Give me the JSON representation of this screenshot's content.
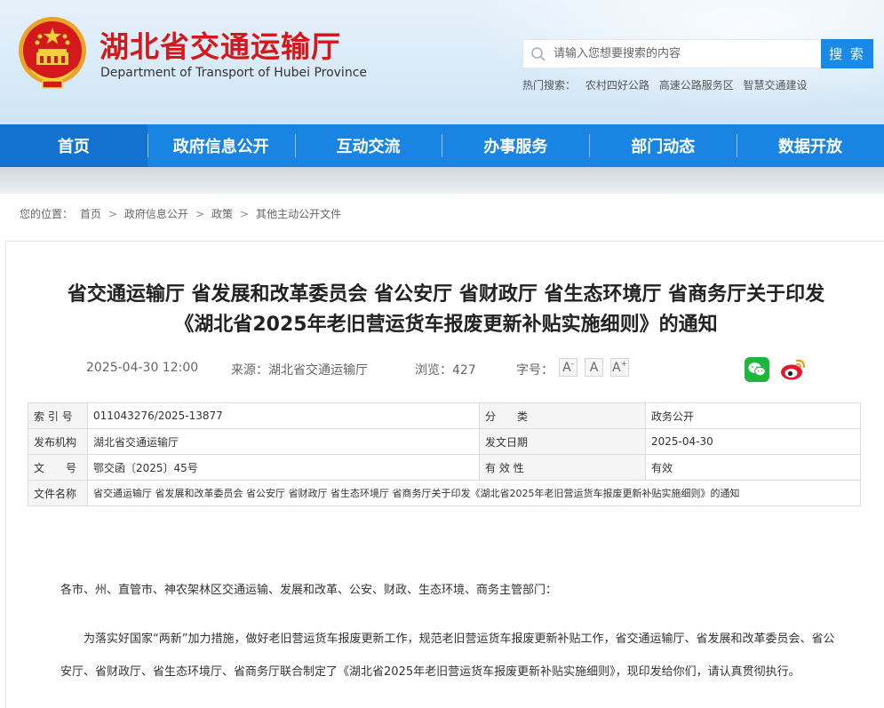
{
  "header": {
    "title": "湖北省交通运输厅",
    "subtitle": "Department of Transport of Hubei Province"
  },
  "search": {
    "placeholder": "请输入您想要搜索的内容",
    "button": "搜 索",
    "hot_label": "热门搜索：",
    "hot_items": [
      "农村四好公路",
      "高速公路服务区",
      "智慧交通建设"
    ]
  },
  "nav": [
    "首页",
    "政府信息公开",
    "互动交流",
    "办事服务",
    "部门动态",
    "数据开放"
  ],
  "breadcrumb": {
    "label": "您的位置：",
    "items": [
      "首页",
      "政府信息公开",
      "政策",
      "其他主动公开文件"
    ],
    "separator": ">"
  },
  "article": {
    "title_line1": "省交通运输厅 省发展和改革委员会 省公安厅 省财政厅 省生态环境厅 省商务厅关于印发",
    "title_line2": "《湖北省2025年老旧营运货车报废更新补贴实施细则》的通知",
    "datetime": "2025-04-30 12:00",
    "source_label": "来源：",
    "source": "湖北省交通运输厅",
    "views_label": "浏览：",
    "views": "427",
    "font_label": "字号：",
    "font_small": "A",
    "font_mid": "A",
    "font_large": "A",
    "font_large_sup": "+",
    "font_small_sup": "-"
  },
  "info_table": {
    "rows": [
      {
        "k1": "索 引 号",
        "v1": "011043276/2025-13877",
        "k2": "分　　类",
        "v2": "政务公开"
      },
      {
        "k1": "发布机构",
        "v1": "湖北省交通运输厅",
        "k2": "发文日期",
        "v2": "2025-04-30"
      },
      {
        "k1": "文　　号",
        "v1": "鄂交函〔2025〕45号",
        "k2": "有 效 性",
        "v2": "有效"
      }
    ],
    "name_label": "文件名称",
    "name_value": "省交通运输厅 省发展和改革委员会 省公安厅 省财政厅 省生态环境厅 省商务厅关于印发《湖北省2025年老旧营运货车报废更新补贴实施细则》的通知"
  },
  "body": {
    "salutation": "各市、州、直管市、神农架林区交通运输、发展和改革、公安、财政、生态环境、商务主管部门：",
    "paragraph1": "为落实好国家“两新”加力措施，做好老旧营运货车报废更新工作，规范老旧营运货车报废更新补贴工作，省交通运输厅、省发展和改革委员会、省公安厅、省财政厅、省生态环境厅、省商务厅联合制定了《湖北省2025年老旧营运货车报废更新补贴实施细则》，现印发给你们，请认真贯彻执行。"
  },
  "colors": {
    "brand_red": "#d3191c",
    "nav_blue": "#1a84e3",
    "search_blue": "#1a8ae8",
    "wechat_green": "#20b53d",
    "weibo_red": "#e6162d"
  },
  "icons": {
    "emblem": "national-emblem-icon",
    "search": "search-icon",
    "wechat": "wechat-icon",
    "weibo": "weibo-icon"
  }
}
